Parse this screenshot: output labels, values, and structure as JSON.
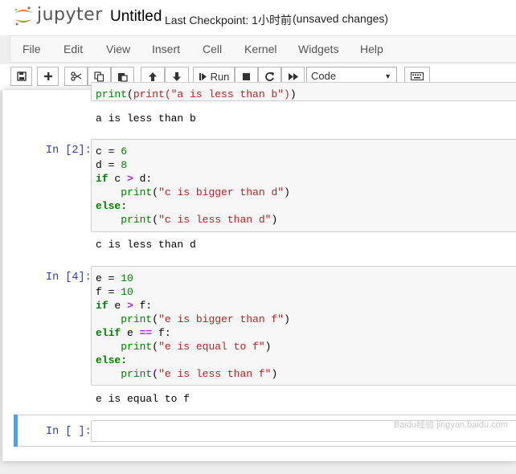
{
  "header": {
    "brand": "jupyter",
    "notebook_title": "Untitled",
    "checkpoint": "Last Checkpoint: 1小时前",
    "unsaved": "(unsaved changes)"
  },
  "menu": [
    "File",
    "Edit",
    "View",
    "Insert",
    "Cell",
    "Kernel",
    "Widgets",
    "Help"
  ],
  "toolbar": {
    "run_label": "Run",
    "cell_type": "Code",
    "icons": [
      "save-icon",
      "plus-icon",
      "scissors-icon",
      "copy-icon",
      "paste-icon",
      "arrow-up-icon",
      "arrow-down-icon",
      "step-forward-icon",
      "stop-icon",
      "refresh-icon",
      "fast-forward-icon",
      "keyboard-icon"
    ]
  },
  "cells": [
    {
      "prompt": "",
      "code": [
        "print(\"a is less than b\")"
      ],
      "output": "a is less than b"
    },
    {
      "prompt": "In [2]:",
      "code": [
        "c = 6",
        "d = 8",
        "if c > d:",
        "    print(\"c is bigger than d\")",
        "else:",
        "    print(\"c is less than d\")"
      ],
      "output": "c is less than d"
    },
    {
      "prompt": "In [4]:",
      "code": [
        "e = 10",
        "f = 10",
        "if e > f:",
        "    print(\"e is bigger than f\")",
        "elif e == f:",
        "    print(\"e is equal to f\")",
        "else:",
        "    print(\"e is less than f\")"
      ],
      "output": "e is equal to f"
    },
    {
      "prompt": "In [ ]:",
      "code": [],
      "output": ""
    }
  ],
  "watermark": "Baidu经验  jingyan.baidu.com",
  "colors": {
    "accent": "#f37726",
    "prompt": "#303f9f",
    "keyword": "#008000",
    "string": "#ba2121",
    "operator": "#aa22ff",
    "selected_cell": "#42a5f5"
  }
}
